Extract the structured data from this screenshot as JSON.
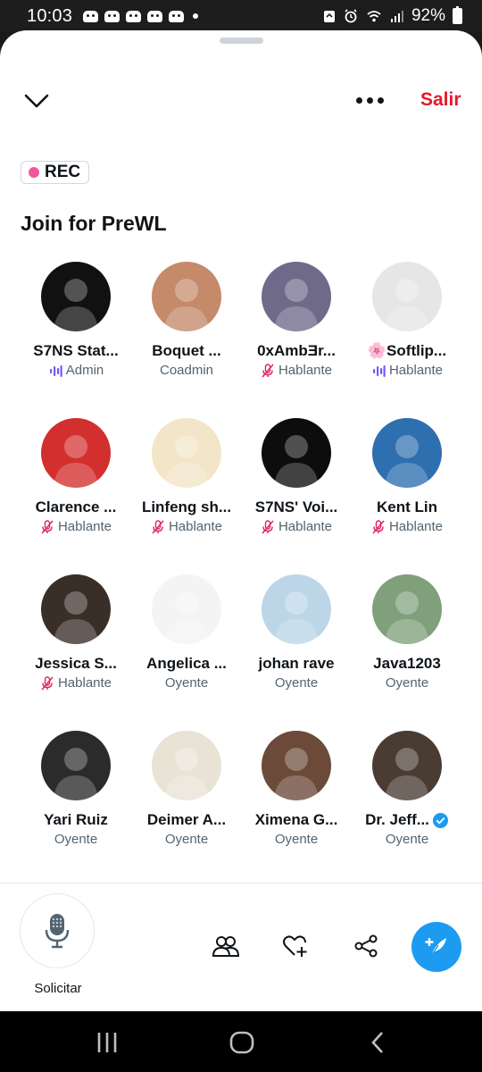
{
  "status_bar": {
    "time": "10:03",
    "battery": "92%",
    "notification_icons": [
      "discord-icon",
      "discord-icon",
      "discord-icon",
      "discord-icon",
      "discord-icon"
    ]
  },
  "header": {
    "leave_label": "Salir"
  },
  "space": {
    "rec_label": "REC",
    "title": "Join for PreWL"
  },
  "participants": [
    {
      "name": "S7NS Stat...",
      "role": "Admin",
      "role_icon": "speaking-bars-icon",
      "avatar_color": "#111111"
    },
    {
      "name": "Boquet ...",
      "role": "Coadmin",
      "role_icon": "",
      "avatar_color": "#c48a6a"
    },
    {
      "name": "0xAmbƎr...",
      "role": "Hablante",
      "role_icon": "mic-off-icon",
      "avatar_color": "#6f6a8a"
    },
    {
      "name": "🌸Softlip...",
      "role": "Hablante",
      "role_icon": "speaking-bars-icon",
      "avatar_color": "#e6e6e6"
    },
    {
      "name": "Clarence ...",
      "role": "Hablante",
      "role_icon": "mic-off-icon",
      "avatar_color": "#d32f2f"
    },
    {
      "name": "Linfeng sh...",
      "role": "Hablante",
      "role_icon": "mic-off-icon",
      "avatar_color": "#f3e6c8"
    },
    {
      "name": "S7NS' Voi...",
      "role": "Hablante",
      "role_icon": "mic-off-icon",
      "avatar_color": "#0d0d0d"
    },
    {
      "name": "Kent Lin",
      "role": "Hablante",
      "role_icon": "mic-off-icon",
      "avatar_color": "#2e6fb0"
    },
    {
      "name": "Jessica S...",
      "role": "Hablante",
      "role_icon": "mic-off-icon",
      "avatar_color": "#3a2e28"
    },
    {
      "name": "Angelica ...",
      "role": "Oyente",
      "role_icon": "",
      "avatar_color": "#f4f4f4"
    },
    {
      "name": "johan rave",
      "role": "Oyente",
      "role_icon": "",
      "avatar_color": "#bcd6e8"
    },
    {
      "name": "Java1203",
      "role": "Oyente",
      "role_icon": "",
      "avatar_color": "#7fa07a"
    },
    {
      "name": "Yari Ruiz",
      "role": "Oyente",
      "role_icon": "",
      "avatar_color": "#2b2b2b"
    },
    {
      "name": "Deimer A...",
      "role": "Oyente",
      "role_icon": "",
      "avatar_color": "#e9e3d6"
    },
    {
      "name": "Ximena G...",
      "role": "Oyente",
      "role_icon": "",
      "avatar_color": "#6b4a3a"
    },
    {
      "name": "Dr. Jeff...",
      "role": "Oyente",
      "role_icon": "",
      "avatar_color": "#4a3b33",
      "verified": true
    }
  ],
  "bottom_bar": {
    "request_label": "Solicitar"
  },
  "colors": {
    "accent": "#1d9bf0",
    "leave": "#e3192b",
    "rec_dot": "#f0579b",
    "speaker_purple": "#7856ff",
    "muted_pink": "#e0245e"
  }
}
